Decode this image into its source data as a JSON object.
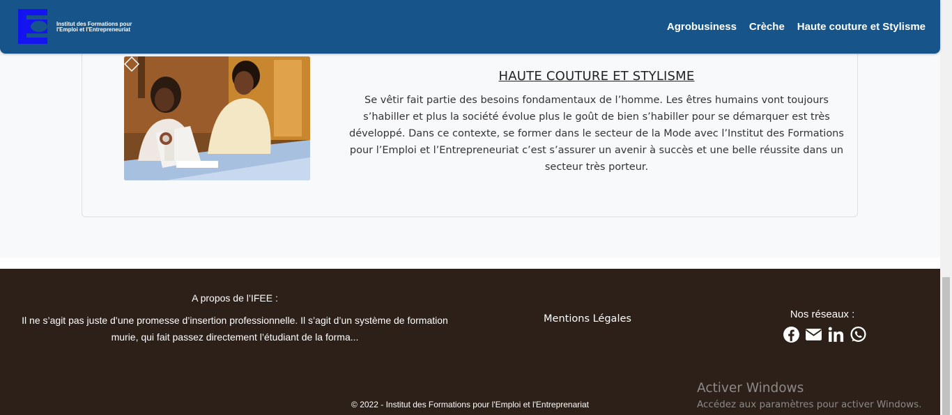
{
  "header": {
    "brand_line1": "Institut des Formations pour",
    "brand_line2": "l'Emploi et l'Entrepreneuriat",
    "brand_color": "#17548a",
    "logo_color": "#1414f0",
    "nav": [
      {
        "label": "Agrobusiness"
      },
      {
        "label": "Crèche"
      },
      {
        "label": "Haute couture et Stylisme"
      }
    ]
  },
  "article": {
    "title": "HAUTE COUTURE ET STYLISME",
    "body": "Se vêtir fait partie des besoins fondamentaux de l’homme. Les êtres humains vont toujours s’habiller et plus la société évolue plus le goût de bien s’habiller pour se démarquer est très développé. Dans ce contexte, se former dans le secteur de la Mode avec l’Institut des Formations pour l’Emploi et l’Entrepreneuriat c’est s’assurer un avenir à succès et une belle réussite dans un secteur très porteur.",
    "image_icon": "sewing-photo"
  },
  "footer": {
    "background": "#2c2018",
    "about_title": "A propos de l’IFEE :",
    "about_text": "Il ne s’agit pas juste d’une promesse d’insertion professionnelle. Il s’agit d’un système de formation murie, qui fait passez directement l’étudiant de la forma...",
    "legal_link": "Mentions Légales",
    "social_title": "Nos réseaux :",
    "social_icons": [
      "facebook-icon",
      "envelope-icon",
      "linkedin-icon",
      "whatsapp-icon"
    ],
    "copyright": "© 2022 - Institut des Formations pour l'Emploi et l'Entreprenariat"
  },
  "windows_watermark": {
    "title": "Activer Windows",
    "subtitle": "Accédez aux paramètres pour activer Windows."
  }
}
